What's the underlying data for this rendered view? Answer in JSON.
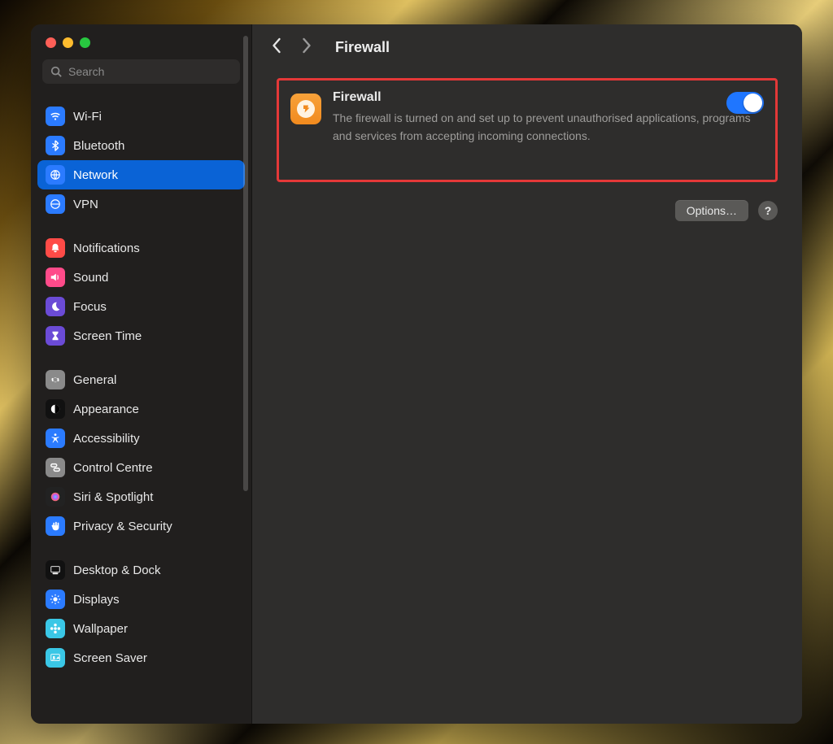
{
  "window": {
    "title": "Firewall"
  },
  "search": {
    "placeholder": "Search"
  },
  "sidebar": {
    "groups": [
      {
        "items": [
          {
            "id": "wifi",
            "label": "Wi-Fi",
            "icon": "wifi-icon",
            "bg": "#2b7bff"
          },
          {
            "id": "bluetooth",
            "label": "Bluetooth",
            "icon": "bluetooth-icon",
            "bg": "#2b7bff"
          },
          {
            "id": "network",
            "label": "Network",
            "icon": "globe-icon",
            "bg": "#2b7bff",
            "selected": true
          },
          {
            "id": "vpn",
            "label": "VPN",
            "icon": "vpn-icon",
            "bg": "#2b7bff"
          }
        ]
      },
      {
        "items": [
          {
            "id": "notifications",
            "label": "Notifications",
            "icon": "bell-icon",
            "bg": "#ff4b47"
          },
          {
            "id": "sound",
            "label": "Sound",
            "icon": "speaker-icon",
            "bg": "#ff4b8a"
          },
          {
            "id": "focus",
            "label": "Focus",
            "icon": "moon-icon",
            "bg": "#6b4bd6"
          },
          {
            "id": "screentime",
            "label": "Screen Time",
            "icon": "hourglass-icon",
            "bg": "#6b4bd6"
          }
        ]
      },
      {
        "items": [
          {
            "id": "general",
            "label": "General",
            "icon": "gear-icon",
            "bg": "#8a8a8a"
          },
          {
            "id": "appearance",
            "label": "Appearance",
            "icon": "appearance-icon",
            "bg": "#111111"
          },
          {
            "id": "accessibility",
            "label": "Accessibility",
            "icon": "accessibility-icon",
            "bg": "#2b7bff"
          },
          {
            "id": "controlcentre",
            "label": "Control Centre",
            "icon": "switches-icon",
            "bg": "#8a8a8a"
          },
          {
            "id": "siri",
            "label": "Siri & Spotlight",
            "icon": "siri-icon",
            "bg": "#222222"
          },
          {
            "id": "privacy",
            "label": "Privacy & Security",
            "icon": "hand-icon",
            "bg": "#2b7bff"
          }
        ]
      },
      {
        "items": [
          {
            "id": "desktopdock",
            "label": "Desktop & Dock",
            "icon": "dock-icon",
            "bg": "#111111"
          },
          {
            "id": "displays",
            "label": "Displays",
            "icon": "sun-icon",
            "bg": "#2b7bff"
          },
          {
            "id": "wallpaper",
            "label": "Wallpaper",
            "icon": "flower-icon",
            "bg": "#3ac7e6"
          },
          {
            "id": "screensaver",
            "label": "Screen Saver",
            "icon": "screensaver-icon",
            "bg": "#3ac7e6"
          }
        ]
      }
    ]
  },
  "main": {
    "breadcrumb_title": "Firewall",
    "firewall": {
      "title": "Firewall",
      "description": "The firewall is turned on and set up to prevent unauthorised applications, programs and services from accepting incoming connections.",
      "enabled": true
    },
    "options_label": "Options…",
    "help_label": "?"
  },
  "colors": {
    "accent": "#0a63d6",
    "toggle": "#1f76ff",
    "highlight": "#e43838"
  }
}
